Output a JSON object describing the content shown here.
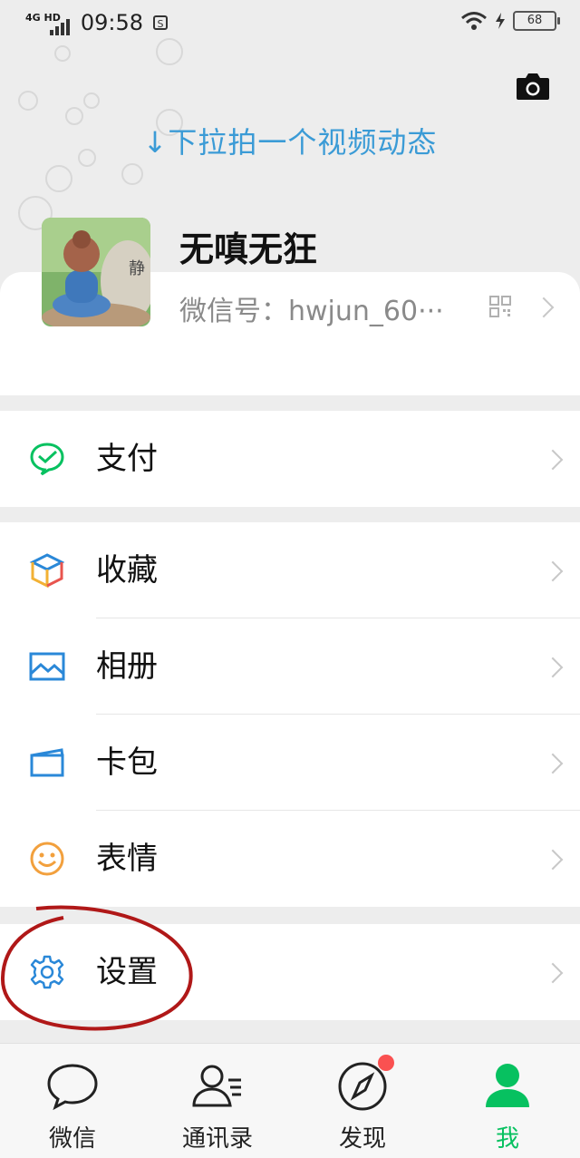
{
  "status_bar": {
    "network": "4G HD",
    "time": "09:58",
    "battery": "68"
  },
  "header": {
    "pull_hint": "↓下拉拍一个视频动态",
    "camera_icon": "camera-icon"
  },
  "profile": {
    "nickname": "无嗔无狂",
    "wechat_id": "微信号：hwjun_60···",
    "qr_icon": "qr-code-icon"
  },
  "menu": {
    "pay": {
      "label": "支付",
      "icon": "pay-icon",
      "color": "#07c160"
    },
    "favorites": {
      "label": "收藏",
      "icon": "favorites-cube-icon"
    },
    "album": {
      "label": "相册",
      "icon": "album-icon",
      "color": "#2a88d8"
    },
    "cards": {
      "label": "卡包",
      "icon": "card-wallet-icon",
      "color": "#2a88d8"
    },
    "stickers": {
      "label": "表情",
      "icon": "smiley-icon",
      "color": "#f2a03d"
    },
    "settings": {
      "label": "设置",
      "icon": "gear-icon",
      "color": "#2a88d8"
    }
  },
  "tabbar": {
    "tabs": [
      {
        "label": "微信",
        "icon": "chat-bubble-icon"
      },
      {
        "label": "通讯录",
        "icon": "contacts-icon"
      },
      {
        "label": "发现",
        "icon": "compass-icon"
      },
      {
        "label": "我",
        "icon": "person-icon",
        "active": true
      }
    ],
    "active_color": "#07c160",
    "badge_color": "#fa5151"
  }
}
